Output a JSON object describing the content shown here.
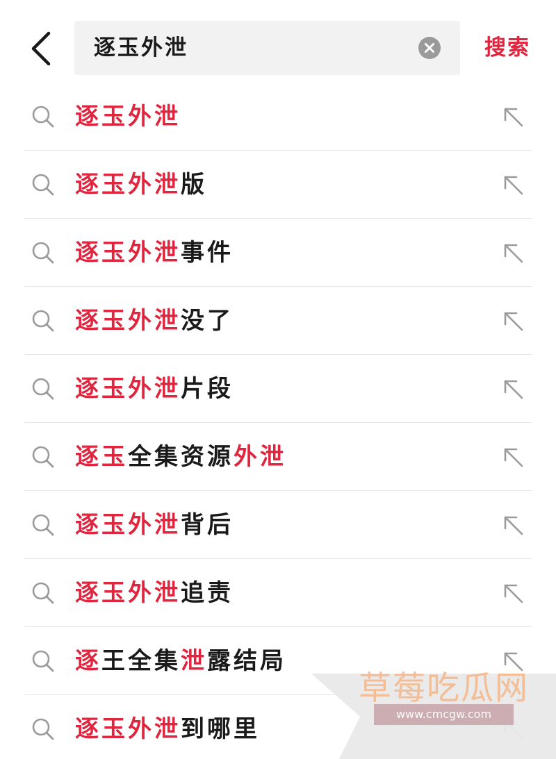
{
  "header": {
    "query": "逐玉外泄",
    "search_label": "搜索",
    "back_icon": "chevron-left-icon",
    "clear_icon": "clear-icon"
  },
  "colors": {
    "accent": "#e0263f",
    "text": "#1a1a1a",
    "icon": "#9a9a9a",
    "search_bg": "#f2f2f2",
    "divider": "#e6e6e6"
  },
  "suggestions": [
    {
      "segments": [
        {
          "text": "逐玉外泄",
          "highlight": true
        }
      ]
    },
    {
      "segments": [
        {
          "text": "逐玉外泄",
          "highlight": true
        },
        {
          "text": "版",
          "highlight": false
        }
      ]
    },
    {
      "segments": [
        {
          "text": "逐玉外泄",
          "highlight": true
        },
        {
          "text": "事件",
          "highlight": false
        }
      ]
    },
    {
      "segments": [
        {
          "text": "逐玉外泄",
          "highlight": true
        },
        {
          "text": "没了",
          "highlight": false
        }
      ]
    },
    {
      "segments": [
        {
          "text": "逐玉外泄",
          "highlight": true
        },
        {
          "text": "片段",
          "highlight": false
        }
      ]
    },
    {
      "segments": [
        {
          "text": "逐玉",
          "highlight": true
        },
        {
          "text": "全集资源",
          "highlight": false
        },
        {
          "text": "外泄",
          "highlight": true
        }
      ]
    },
    {
      "segments": [
        {
          "text": "逐玉外泄",
          "highlight": true
        },
        {
          "text": "背后",
          "highlight": false
        }
      ]
    },
    {
      "segments": [
        {
          "text": "逐玉外泄",
          "highlight": true
        },
        {
          "text": "追责",
          "highlight": false
        }
      ]
    },
    {
      "segments": [
        {
          "text": "逐",
          "highlight": true
        },
        {
          "text": "王全集",
          "highlight": false
        },
        {
          "text": "泄",
          "highlight": true
        },
        {
          "text": "露结局",
          "highlight": false
        }
      ]
    },
    {
      "segments": [
        {
          "text": "逐玉外泄",
          "highlight": true
        },
        {
          "text": "到哪里",
          "highlight": false
        }
      ]
    }
  ],
  "row_icons": {
    "left": "search-icon",
    "right": "fill-arrow-icon"
  },
  "watermark": {
    "title": "草莓吃瓜网",
    "url": "www.cmcgw.com"
  }
}
